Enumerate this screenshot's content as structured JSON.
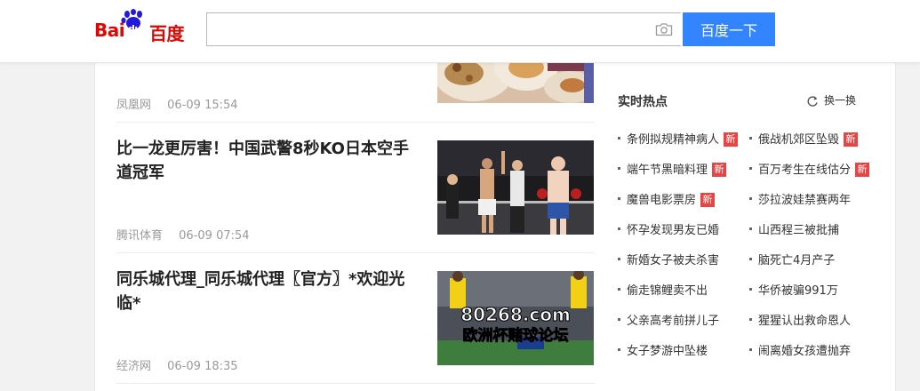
{
  "header": {
    "logo_latin": "Bai",
    "logo_du": "du",
    "logo_cn": "百度",
    "search_value": "",
    "search_button": "百度一下"
  },
  "news": [
    {
      "source": "凤凰网",
      "time": "06-09 15:54"
    },
    {
      "title": "比一龙更厉害！中国武警8秒KO日本空手道冠军",
      "source": "腾讯体育",
      "time": "06-09 07:54"
    },
    {
      "title": "同乐城代理_同乐城代理〖官方〗*欢迎光临*",
      "source": "经济网",
      "time": "06-09 18:35",
      "thumb_text_1": "80268.com",
      "thumb_text_2": "欧洲杯赌球论坛"
    }
  ],
  "hot": {
    "title": "实时热点",
    "refresh": "换一换",
    "new_badge": "新",
    "left": [
      {
        "label": "条例拟规精神病人",
        "new": true
      },
      {
        "label": "端午节黑暗料理",
        "new": true
      },
      {
        "label": "魔兽电影票房",
        "new": true
      },
      {
        "label": "怀孕发现男友已婚",
        "new": false
      },
      {
        "label": "新婚女子被夫杀害",
        "new": false
      },
      {
        "label": "偷走锦鲤卖不出",
        "new": false
      },
      {
        "label": "父亲高考前拼儿子",
        "new": false
      },
      {
        "label": "女子梦游中坠楼",
        "new": false
      }
    ],
    "right": [
      {
        "label": "俄战机郊区坠毁",
        "new": true
      },
      {
        "label": "百万考生在线估分",
        "new": true
      },
      {
        "label": "莎拉波娃禁赛两年",
        "new": false
      },
      {
        "label": "山西程三被批捕",
        "new": false
      },
      {
        "label": "脑死亡4月产子",
        "new": false
      },
      {
        "label": "华侨被骗991万",
        "new": false
      },
      {
        "label": "猩猩认出救命恩人",
        "new": false
      },
      {
        "label": "闹离婚女孩遭抛弃",
        "new": false
      }
    ]
  },
  "colors": {
    "brand_red": "#e10601",
    "brand_blue": "#2319dc",
    "button_blue": "#3385ff",
    "badge_red": "#e94343"
  }
}
